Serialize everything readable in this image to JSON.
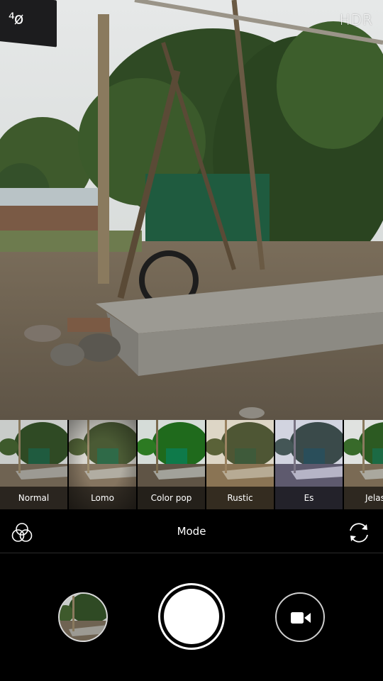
{
  "viewfinder": {
    "flash_icon": "flash-auto-icon",
    "flash_text": "⁴ø",
    "hdr_label": "HDR"
  },
  "filters": {
    "selected": "Normal",
    "items": [
      {
        "label": "Normal",
        "selected": true
      },
      {
        "label": "Lomo",
        "selected": false
      },
      {
        "label": "Color pop",
        "selected": false
      },
      {
        "label": "Rustic",
        "selected": false
      },
      {
        "label": "Es",
        "selected": false
      },
      {
        "label": "Jelas",
        "selected": false
      }
    ]
  },
  "mode_bar": {
    "filters_icon": "filters-icon",
    "mode_label": "Mode",
    "switch_icon": "switch-camera-icon"
  },
  "controls": {
    "gallery_icon": "gallery-thumbnail",
    "shutter_icon": "shutter-icon",
    "video_icon": "video-camera-icon"
  },
  "colors": {
    "selection_accent": "#2aa6ff",
    "background": "#000000",
    "shutter": "#ffffff"
  }
}
